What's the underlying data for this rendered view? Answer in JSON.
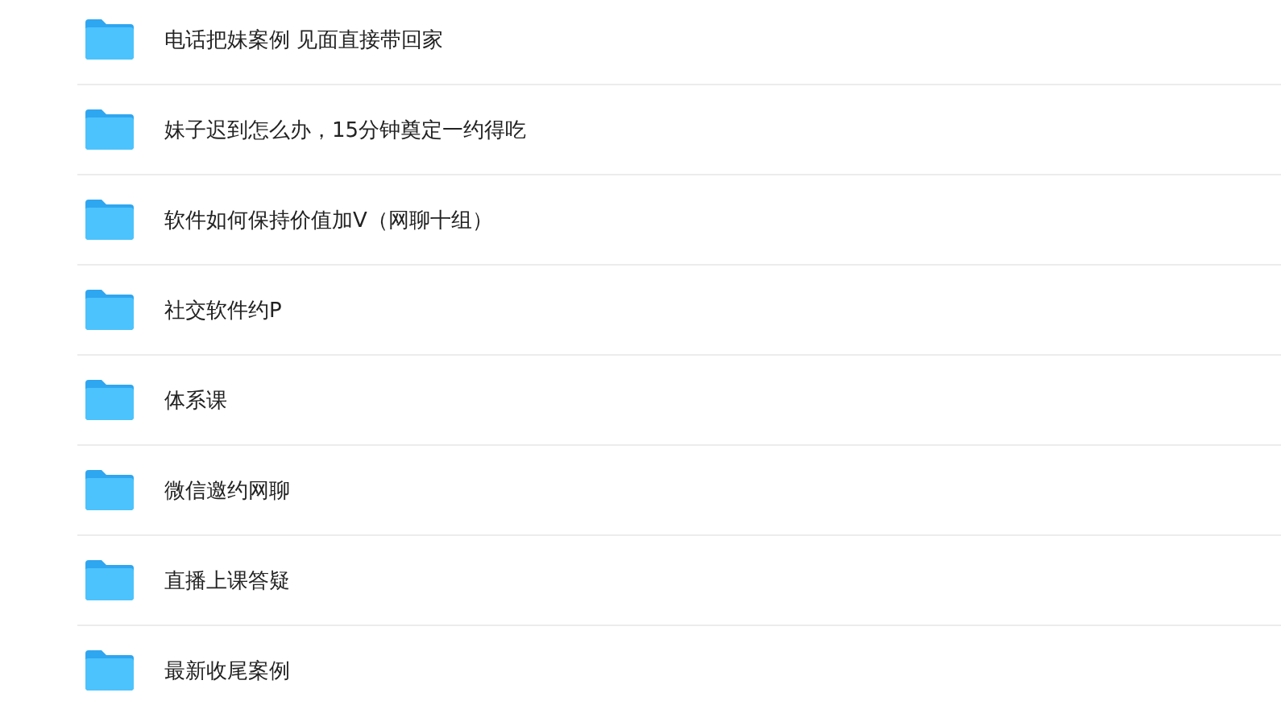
{
  "folders": [
    {
      "name": "电话把妹案例 见面直接带回家"
    },
    {
      "name": "妹子迟到怎么办，15分钟奠定一约得吃"
    },
    {
      "name": "软件如何保持价值加V（网聊十组）"
    },
    {
      "name": "社交软件约P"
    },
    {
      "name": "体系课"
    },
    {
      "name": "微信邀约网聊"
    },
    {
      "name": "直播上课答疑"
    },
    {
      "name": "最新收尾案例"
    }
  ]
}
